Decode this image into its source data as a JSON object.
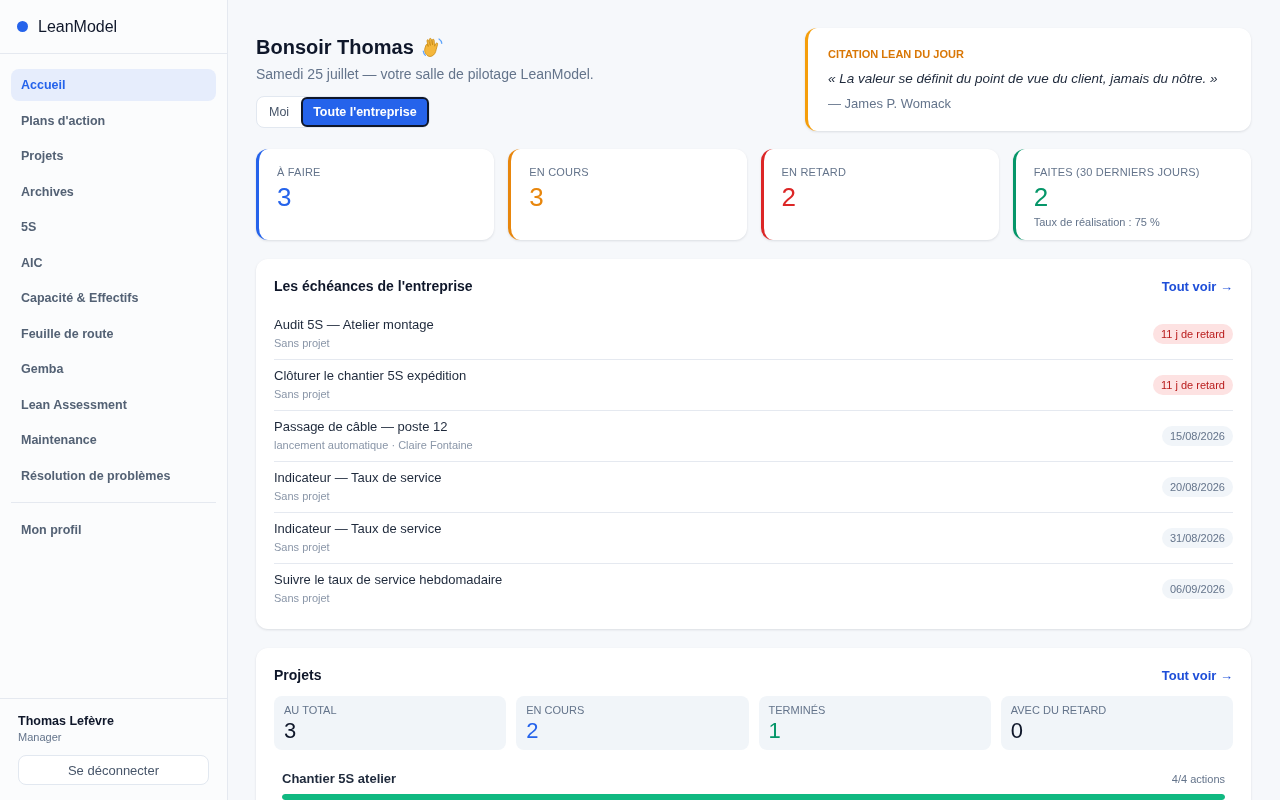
{
  "sidebar": {
    "brand": "LeanModel",
    "nav_items": [
      {
        "label": "Accueil",
        "selected": true
      },
      {
        "label": "Plans d'action",
        "selected": false
      },
      {
        "label": "Projets",
        "selected": false
      },
      {
        "label": "Archives",
        "selected": false
      },
      {
        "label": "5S",
        "selected": false
      },
      {
        "label": "AIC",
        "selected": false
      },
      {
        "label": "Capacité & Effectifs",
        "selected": false
      },
      {
        "label": "Feuille de route",
        "selected": false
      },
      {
        "label": "Gemba",
        "selected": false
      },
      {
        "label": "Lean Assessment",
        "selected": false
      },
      {
        "label": "Maintenance",
        "selected": false
      },
      {
        "label": "Résolution de problèmes",
        "selected": false
      }
    ],
    "secondary_items": [
      {
        "label": "Mon profil",
        "selected": false
      }
    ],
    "user": {
      "name": "Thomas Lefèvre",
      "role": "Manager"
    },
    "logout_button": "Se déconnecter"
  },
  "header": {
    "greeting": "Bonsoir Thomas",
    "subtitle": "Samedi 25 juillet — votre salle de pilotage LeanModel.",
    "scope_tabs": [
      {
        "label": "Moi",
        "selected": false
      },
      {
        "label": "Toute l'entreprise",
        "selected": true
      }
    ]
  },
  "quote": {
    "label": "CITATION LEAN DU JOUR",
    "text": "« La valeur se définit du point de vue du client, jamais du nôtre. »",
    "author": "— James P. Womack"
  },
  "stats": [
    {
      "label": "À FAIRE",
      "value": "3",
      "color": "#2563eb"
    },
    {
      "label": "EN COURS",
      "value": "3",
      "color": "#e8860c"
    },
    {
      "label": "EN RETARD",
      "value": "2",
      "color": "#dc2626"
    },
    {
      "label": "FAITES (30 DERNIERS JOURS)",
      "value": "2",
      "note": "Taux de réalisation : 75 %",
      "color": "#059669"
    }
  ],
  "deadlines": {
    "title": "Les échéances de l'entreprise",
    "link": "Tout voir →",
    "items": [
      {
        "title": "Audit 5S — Atelier montage",
        "subtitle": "Sans projet",
        "badge": "11 j de retard",
        "kind": "overdue"
      },
      {
        "title": "Clôturer le chantier 5S expédition",
        "subtitle": "Sans projet",
        "badge": "11 j de retard",
        "kind": "overdue"
      },
      {
        "title": "Passage de câble — poste 12",
        "subtitle": "lancement automatique · Claire Fontaine",
        "badge": "15/08/2026",
        "kind": "date"
      },
      {
        "title": "Indicateur — Taux de service",
        "subtitle": "Sans projet",
        "badge": "20/08/2026",
        "kind": "date"
      },
      {
        "title": "Indicateur — Taux de service",
        "subtitle": "Sans projet",
        "badge": "31/08/2026",
        "kind": "date"
      },
      {
        "title": "Suivre le taux de service hebdomadaire",
        "subtitle": "Sans projet",
        "badge": "06/09/2026",
        "kind": "date"
      }
    ]
  },
  "projects": {
    "title": "Projets",
    "link": "Tout voir →",
    "stats": [
      {
        "label": "AU TOTAL",
        "value": "3",
        "color": "#0f172a"
      },
      {
        "label": "EN COURS",
        "value": "2",
        "color": "#2563eb"
      },
      {
        "label": "TERMINÉS",
        "value": "1",
        "color": "#059669"
      },
      {
        "label": "AVEC DU RETARD",
        "value": "0",
        "color": "#0f172a"
      }
    ],
    "items": [
      {
        "name": "Chantier 5S atelier",
        "count": "4/4 actions",
        "level": 1
      }
    ]
  }
}
